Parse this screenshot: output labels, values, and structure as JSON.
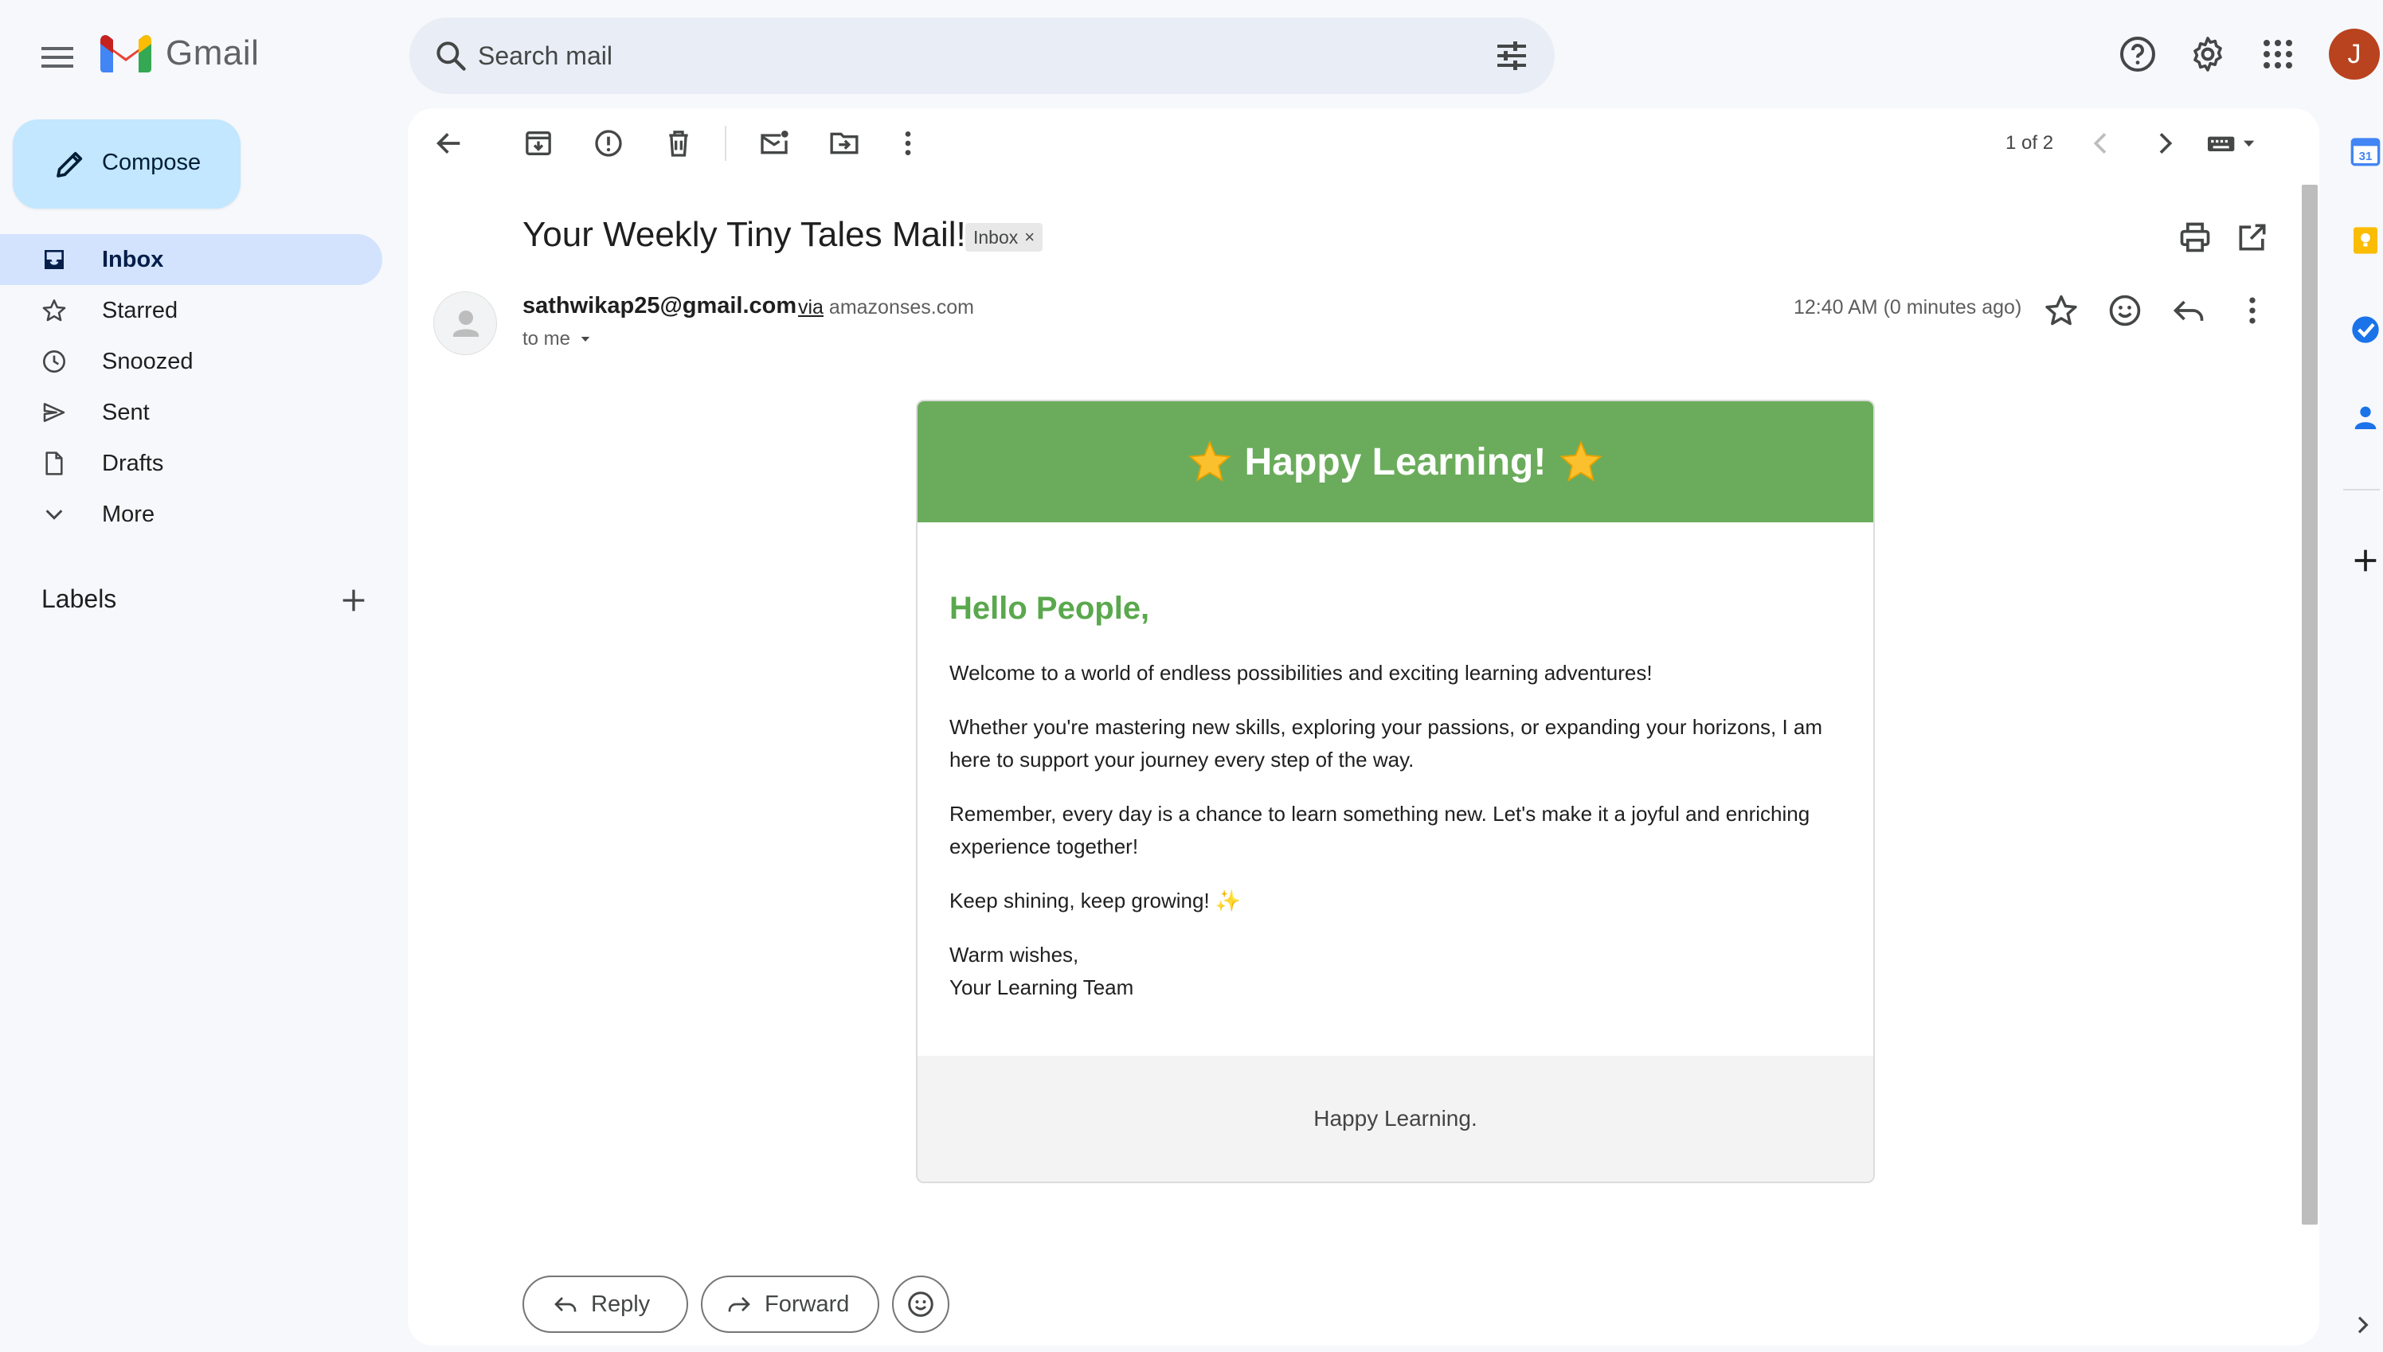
{
  "app": {
    "name": "Gmail"
  },
  "search": {
    "placeholder": "Search mail"
  },
  "account": {
    "initial": "J",
    "color": "#b8431e"
  },
  "compose": {
    "label": "Compose"
  },
  "nav": {
    "items": [
      {
        "label": "Inbox",
        "icon": "inbox-icon",
        "active": true
      },
      {
        "label": "Starred",
        "icon": "star-icon"
      },
      {
        "label": "Snoozed",
        "icon": "clock-icon"
      },
      {
        "label": "Sent",
        "icon": "send-icon"
      },
      {
        "label": "Drafts",
        "icon": "draft-icon"
      },
      {
        "label": "More",
        "icon": "chevron-down-icon"
      }
    ]
  },
  "labels": {
    "header": "Labels"
  },
  "pager": {
    "text": "1 of 2"
  },
  "message": {
    "subject": "Your Weekly Tiny Tales Mail!",
    "chip": "Inbox",
    "sender": "sathwikap25@gmail.com",
    "via_label": "via",
    "via_domain": "amazonses.com",
    "to": "to me",
    "time": "12:40 AM (0 minutes ago)"
  },
  "email": {
    "banner": "Happy Learning!",
    "greeting": "Hello People,",
    "paragraphs": [
      "Welcome to a world of endless possibilities and exciting learning adventures!",
      "Whether you're mastering new skills, exploring your passions, or expanding your horizons, I am here to support your journey every step of the way.",
      "Remember, every day is a chance to learn something new. Let's make it a joyful and enriching experience together!",
      "Keep shining, keep growing! ✨"
    ],
    "sign_line1": "Warm wishes,",
    "sign_line2": "Your Learning Team",
    "footer": "Happy Learning."
  },
  "actions": {
    "reply": "Reply",
    "forward": "Forward"
  },
  "side_panel": {
    "calendar_day": "31"
  },
  "colors": {
    "banner_green": "#6aac5b",
    "greeting_green": "#5aa84d",
    "active_nav": "#d3e3fd",
    "compose_bg": "#c2e7ff"
  }
}
